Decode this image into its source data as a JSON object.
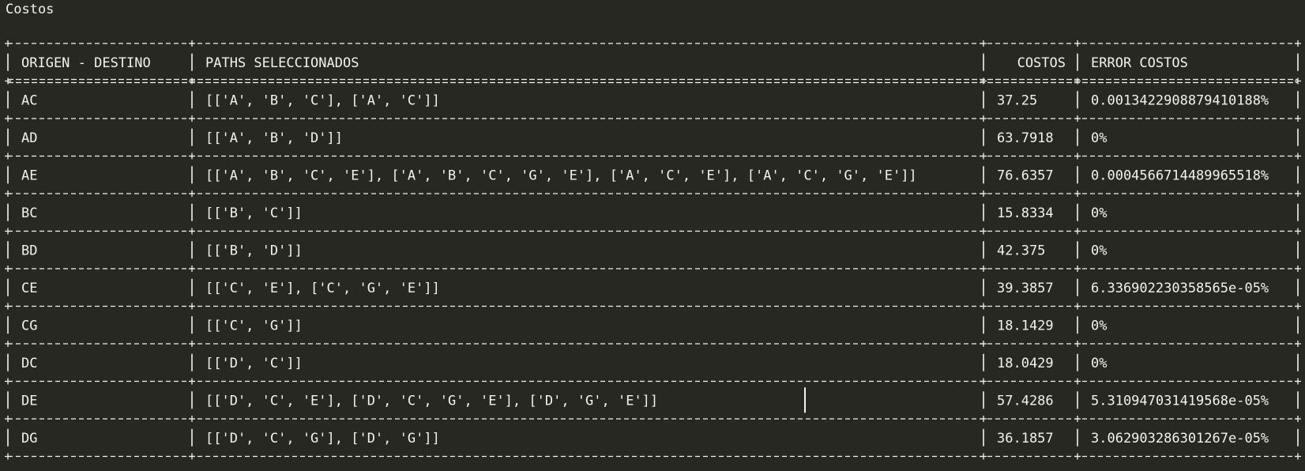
{
  "page": {
    "title": "Costos"
  },
  "table": {
    "headers": [
      "ORIGEN - DESTINO",
      "PATHS SELECCIONADOS",
      "COSTOS",
      "ERROR COSTOS"
    ],
    "rows": [
      [
        "AC",
        "[['A', 'B', 'C'], ['A', 'C']]",
        "37.25",
        "0.0013422908879410188%"
      ],
      [
        "AD",
        "[['A', 'B', 'D']]",
        "63.7918",
        "0%"
      ],
      [
        "AE",
        "[['A', 'B', 'C', 'E'], ['A', 'B', 'C', 'G', 'E'], ['A', 'C', 'E'], ['A', 'C', 'G', 'E']]",
        "76.6357",
        "0.0004566714489965518%"
      ],
      [
        "BC",
        "[['B', 'C']]",
        "15.8334",
        "0%"
      ],
      [
        "BD",
        "[['B', 'D']]",
        "42.375",
        "0%"
      ],
      [
        "CE",
        "[['C', 'E'], ['C', 'G', 'E']]",
        "39.3857",
        "6.336902230358565e-05%"
      ],
      [
        "CG",
        "[['C', 'G']]",
        "18.1429",
        "0%"
      ],
      [
        "DC",
        "[['D', 'C']]",
        "18.0429",
        "0%"
      ],
      [
        "DE",
        "[['D', 'C', 'E'], ['D', 'C', 'G', 'E'], ['D', 'G', 'E']]",
        "57.4286",
        "5.310947031419568e-05%"
      ],
      [
        "DG",
        "[['D', 'C', 'G'], ['D', 'G']]",
        "36.1857",
        "3.062903286301267e-05%"
      ]
    ]
  }
}
